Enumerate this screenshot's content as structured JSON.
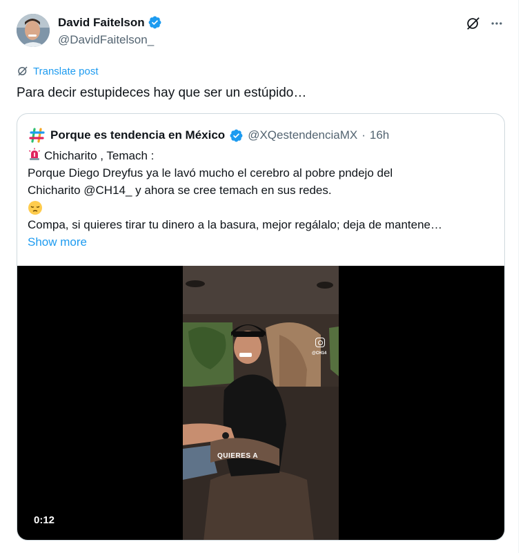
{
  "author": {
    "display_name": "David Faitelson",
    "handle": "@DavidFaitelson_"
  },
  "actions": {
    "grok_icon": "grok-icon",
    "more_icon": "more-icon"
  },
  "translate": {
    "label": "Translate post"
  },
  "post": {
    "text": "Para decir estupideces hay que ser un estúpido…"
  },
  "quote": {
    "display_name": "Porque es tendencia en México",
    "handle": "@XQestendenciaMX",
    "separator": "·",
    "time": "16h",
    "lines": [
      "Chicharito , Temach :",
      "Porque Diego Dreyfus ya le lavó mucho el cerebro al pobre pndejo del",
      "Chicharito @CH14_ y ahora se cree temach en sus redes.",
      "Compa, si quieres tirar tu dinero a la basura, mejor regálalo; deja de mantene…"
    ],
    "show_more": "Show more"
  },
  "video": {
    "caption": "QUIERES A",
    "ig_handle": "@CH14",
    "elapsed": "0:12"
  },
  "colors": {
    "accent": "#1d9bf0",
    "secondary_text": "#536471",
    "border": "#cfd9de"
  }
}
